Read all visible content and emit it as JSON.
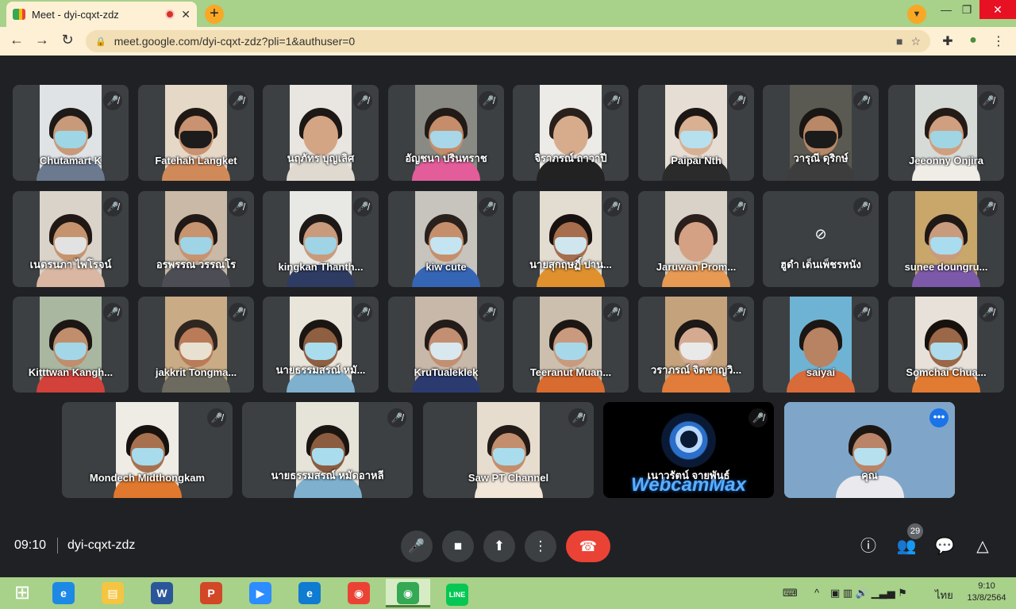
{
  "browser": {
    "tab_title": "Meet - dyi-cqxt-zdz",
    "tab_close": "✕",
    "new_tab": "+",
    "profile": "▼",
    "window_controls": {
      "minimize": "—",
      "restore": "❐",
      "close": "✕"
    },
    "nav": {
      "back": "←",
      "forward": "→",
      "reload": "↻"
    },
    "url": "meet.google.com/dyi-cqxt-zdz?pli=1&authuser=0",
    "lock": "🔒",
    "omni_icons": {
      "camera": "■",
      "star": "☆"
    },
    "toolbar_icons": {
      "extensions": "✚",
      "profile": "●",
      "menu": "⋮"
    }
  },
  "tiles": [
    {
      "name": "Chutamart K",
      "mic": "🎤̸",
      "bg": "#dfe3e6",
      "skin": "#c89a7a",
      "hair": "#1e1a18",
      "mask": "#9fd6e6",
      "shirt": "#6b7a8f"
    },
    {
      "name": "Fatehah Langket",
      "mic": "🎤̸",
      "bg": "#e6d8c7",
      "skin": "#c99270",
      "hair": "#201814",
      "mask": "#1c1c1c",
      "shirt": "#d08a5a"
    },
    {
      "name": "นฤภัทร บุญเลิศ",
      "mic": "🎤̸",
      "bg": "#e9e6e2",
      "skin": "#d3a584",
      "hair": "#1d1715",
      "mask": "#d3a584",
      "shirt": "#e0d9cf"
    },
    {
      "name": "อัญชนา ปรินทราช",
      "mic": "🎤̸",
      "bg": "#8a8a84",
      "skin": "#c58d6a",
      "hair": "#221a16",
      "mask": "#a7d7e8",
      "shirt": "#e35d9a"
    },
    {
      "name": "จิราภรณ์ ถาวาปี",
      "mic": "🎤̸",
      "bg": "#ecebe7",
      "skin": "#d7ac8d",
      "hair": "#2a201b",
      "mask": "#d7ac8d",
      "shirt": "#222222"
    },
    {
      "name": "Paipai Nth",
      "mic": "🎤̸",
      "bg": "#e6ded5",
      "skin": "#d9b092",
      "hair": "#1c1715",
      "mask": "#b7e0ef",
      "shirt": "#2b2b2b"
    },
    {
      "name": "วารุณี ดุริกษ์",
      "mic": "🎤̸",
      "bg": "#5a5a52",
      "skin": "#b98867",
      "hair": "#1a1613",
      "mask": "#1b1b1b",
      "shirt": "#3d3d3d"
    },
    {
      "name": "Jeeonny Onjira",
      "mic": "🎤̸",
      "bg": "#d7dbd8",
      "skin": "#cf9f7f",
      "hair": "#241b17",
      "mask": "#a0d5e4",
      "shirt": "#f0ece6"
    },
    {
      "name": "เนตรนภา ไพโรจน์",
      "mic": "🎤̸",
      "bg": "#d9d3ca",
      "skin": "#c5946f",
      "hair": "#1f1815",
      "mask": "#e2e2e2",
      "shirt": "#d9b7a2"
    },
    {
      "name": "อรพรรณ วรรณโร",
      "mic": "🎤̸",
      "bg": "#c9b9a6",
      "skin": "#c8936f",
      "hair": "#211915",
      "mask": "#9fd3e6",
      "shirt": "#4d4d55"
    },
    {
      "name": "kingkan Thanth...",
      "mic": "🎤̸",
      "bg": "#e8e8e4",
      "skin": "#c99b7c",
      "hair": "#1e1816",
      "mask": "#9fd3e6",
      "shirt": "#2e3c63"
    },
    {
      "name": "kiw cute",
      "mic": "🎤̸",
      "bg": "#c7c3bd",
      "skin": "#c68f6c",
      "hair": "#2a211c",
      "mask": "#c3e4f0",
      "shirt": "#3565b5"
    },
    {
      "name": "นายสุกฤษฏิ์ ปาน...",
      "mic": "🎤̸",
      "bg": "#e3dcd0",
      "skin": "#a66e4d",
      "hair": "#17120f",
      "mask": "#cfe6ee",
      "shirt": "#e0912e"
    },
    {
      "name": "Jaruwan Prom...",
      "mic": "🎤̸",
      "bg": "#d8d2c8",
      "skin": "#d4a184",
      "hair": "#2a1f1a",
      "mask": "#d4a184",
      "shirt": "#e79a53"
    },
    {
      "name": "ฮูดำ เด็นเพ็ชรหนัง",
      "mic": "🎤̸",
      "camoff": "⊘",
      "bg": "#3c4043"
    },
    {
      "name": "sunee doungru...",
      "mic": "🎤̸",
      "bg": "#c9a66a",
      "skin": "#c99b7d",
      "hair": "#1f1915",
      "mask": "#a9dcee",
      "shirt": "#7d5aa9"
    },
    {
      "name": "Kitttwan Kangh...",
      "mic": "🎤̸",
      "bg": "#a9b7a1",
      "skin": "#c08e6c",
      "hair": "#1c1614",
      "mask": "#a3d7e8",
      "shirt": "#d2423a"
    },
    {
      "name": "jakkrit Tongma...",
      "mic": "🎤̸",
      "bg": "#c9ab86",
      "skin": "#b97b58",
      "hair": "#2f2620",
      "mask": "#e8e0d0",
      "shirt": "#6d6a5f"
    },
    {
      "name": "นายธรรมสรณ์ หมั...",
      "mic": "🎤̸",
      "bg": "#e9e5da",
      "skin": "#8f5f42",
      "hair": "#1c1612",
      "mask": "#a9dced",
      "shirt": "#7fb1cf"
    },
    {
      "name": "KruTualeklek",
      "mic": "🎤̸",
      "bg": "#c8b8a9",
      "skin": "#c28f72",
      "hair": "#241c18",
      "mask": "#d9e8ee",
      "shirt": "#2b3b70"
    },
    {
      "name": "Teeranut Muan...",
      "mic": "🎤̸",
      "bg": "#cdbfae",
      "skin": "#c99a7e",
      "hair": "#1d1714",
      "mask": "#a7d8ea",
      "shirt": "#d86b2f"
    },
    {
      "name": "วราภรณ์ จิตชาญวิ...",
      "mic": "🎤̸",
      "bg": "#c4a37c",
      "skin": "#d4ab90",
      "hair": "#1e1816",
      "mask": "#e9e9e9",
      "shirt": "#e17c3b"
    },
    {
      "name": "saiyai",
      "mic": "🎤̸",
      "bg": "#6fb3d4",
      "skin": "#b88363",
      "hair": "#1b1613",
      "mask": "#b88363",
      "shirt": "#d96b3a"
    },
    {
      "name": "Somchai Chua...",
      "mic": "🎤̸",
      "bg": "#e7e1da",
      "skin": "#9a6748",
      "hair": "#17110e",
      "mask": "#aedcec",
      "shirt": "#e17b31"
    },
    {
      "name": "Mondech Midthongkam",
      "mic": "🎤̸",
      "bg": "#efece6",
      "skin": "#a7714f",
      "hair": "#17120f",
      "mask": "#a8dbec",
      "shirt": "#e0782e"
    },
    {
      "name": "นายธรรมสรณ์ หมัดอาหลี",
      "mic": "🎤̸",
      "bg": "#e6e3d9",
      "skin": "#8b5c40",
      "hair": "#1b1511",
      "mask": "#a9dced",
      "shirt": "#7fb1cf"
    },
    {
      "name": "Saw PT Channel",
      "mic": "🎤̸",
      "bg": "#e7ddcf",
      "skin": "#c28e6e",
      "hair": "#231b17",
      "mask": "#a9dced",
      "shirt": "#f1e6d8"
    },
    {
      "name": "เนาวรัตน์ จายพันธ์",
      "mic": "🎤̸",
      "webcam": "WebcamMax",
      "bg": "#000000"
    },
    {
      "name": "คุณ",
      "dots": "•••",
      "bg": "#7fa6c9",
      "skin": "#b98467",
      "hair": "#1c1613",
      "mask": "#b7e0ef",
      "shirt": "#e9e9ee",
      "self": true
    }
  ],
  "controls": {
    "time": "09:10",
    "meeting_code": "dyi-cqxt-zdz",
    "mic": "🎤",
    "camera": "■",
    "present": "⬆",
    "more": "⋮",
    "hangup": "☎",
    "info": "ⓘ",
    "people": "👥",
    "people_count": "29",
    "chat": "💬",
    "activities": "△"
  },
  "taskbar": {
    "start": "⊞",
    "apps": [
      {
        "glyph": "e",
        "color": "#1e88e5"
      },
      {
        "glyph": "▤",
        "color": "#f4c542"
      },
      {
        "glyph": "W",
        "color": "#2b579a"
      },
      {
        "glyph": "P",
        "color": "#d24726"
      },
      {
        "glyph": "▶",
        "color": "#2d8cff"
      },
      {
        "glyph": "e",
        "color": "#0f7bd1"
      },
      {
        "glyph": "◉",
        "color": "#ea4335"
      },
      {
        "glyph": "◉",
        "color": "#34a853"
      },
      {
        "glyph": "LINE",
        "color": "#06c755"
      }
    ],
    "tray": {
      "keyboard": "⌨",
      "chevron": "^",
      "icons": "▣ ▥ 🔊 ▁▃▅ ⚑",
      "lang": "ไทย"
    },
    "clock_time": "9:10",
    "clock_date": "13/8/2564"
  }
}
